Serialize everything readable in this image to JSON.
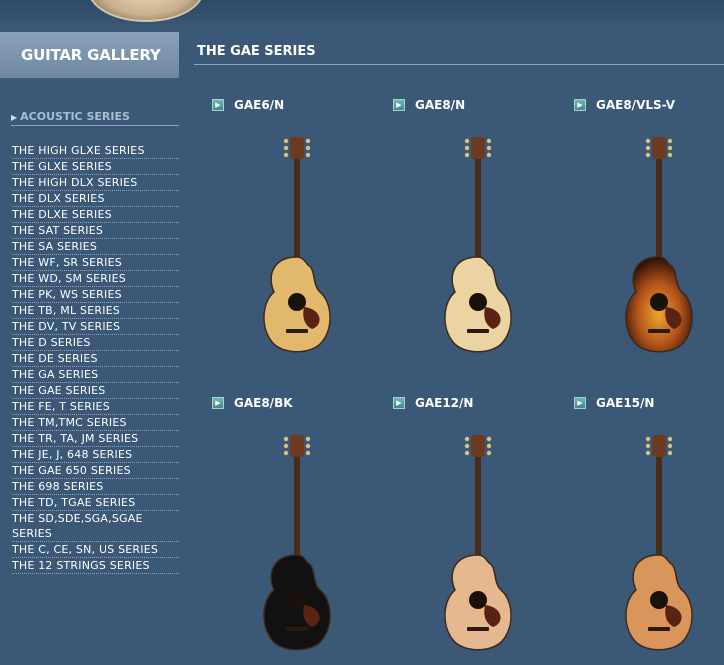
{
  "sidebar": {
    "header": "GUITAR GALLERY",
    "section_title": "ACOUSTIC SERIES",
    "items": [
      "THE HIGH GLXE SERIES",
      "THE GLXE SERIES",
      "THE HIGH DLX SERIES",
      "THE DLX SERIES",
      "THE DLXE SERIES",
      "THE SAT SERIES",
      "THE SA SERIES",
      "THE WF, SR SERIES",
      "THE WD, SM SERIES",
      "THE PK, WS SERIES",
      "THE TB, ML SERIES",
      "THE DV, TV SERIES",
      "THE D SERIES",
      "THE DE SERIES",
      "THE GA SERIES",
      "THE GAE SERIES",
      "THE FE, T SERIES",
      "THE TM,TMC SERIES",
      "THE TR, TA, JM SERIES",
      "THE JE, J, 648 SERIES",
      "THE GAE 650 SERIES",
      "THE 698 SERIES",
      "THE TD, TGAE SERIES",
      "THE SD,SDE,SGA,SGAE SERIES",
      "THE C, CE, SN, US SERIES",
      "THE 12 STRINGS SERIES"
    ]
  },
  "main": {
    "title": "THE GAE SERIES",
    "products": [
      {
        "label": "GAE6/N",
        "finish": "natural",
        "color": "#e2b86c"
      },
      {
        "label": "GAE8/N",
        "finish": "natural",
        "color": "#ecd3a2"
      },
      {
        "label": "GAE8/VLS-V",
        "finish": "sunburst",
        "color": "#b2531a"
      },
      {
        "label": "GAE8/BK",
        "finish": "black",
        "color": "#111111"
      },
      {
        "label": "GAE12/N",
        "finish": "natural",
        "color": "#e6b890"
      },
      {
        "label": "GAE15/N",
        "finish": "natural",
        "color": "#d9955a"
      }
    ]
  }
}
